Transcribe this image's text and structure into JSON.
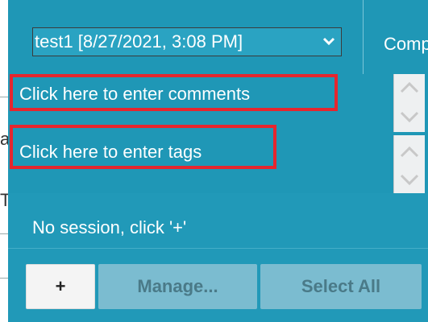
{
  "session_select": {
    "selected": "test1 [8/27/2021, 3:08 PM]"
  },
  "topbar": {
    "comp_label": "Comp"
  },
  "comments": {
    "placeholder": "Click here to enter comments"
  },
  "tags": {
    "placeholder": "Click here to enter tags"
  },
  "session_status": "No session, click '+'",
  "buttons": {
    "add": "+",
    "manage": "Manage...",
    "select_all": "Select All"
  },
  "colors": {
    "panel": "#2199b8",
    "highlight": "#e5262e"
  }
}
